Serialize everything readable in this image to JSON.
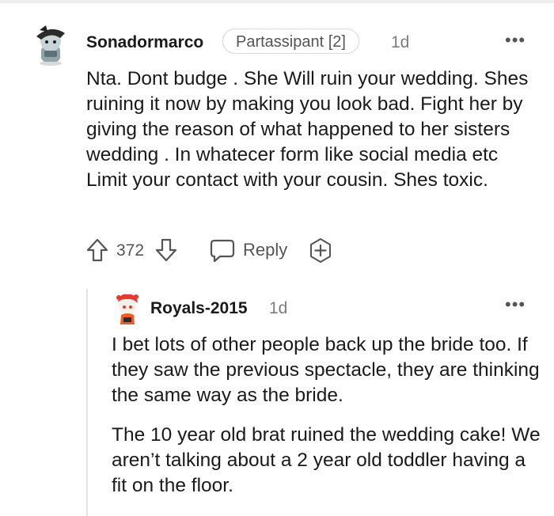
{
  "comment": {
    "username": "Sonadormarco",
    "flair": "Partassipant [2]",
    "age": "1d",
    "more": "•••",
    "body": "Nta. Dont budge . She Will ruin your wedding. Shes ruining it now by making you look bad. Fight her by giving the reason of what happened to her sisters wedding . In whatecer form like social media etc Limit your contact with your cousin. Shes toxic.",
    "actions": {
      "score": "372",
      "reply_label": "Reply"
    }
  },
  "reply": {
    "username": "Royals-2015",
    "age": "1d",
    "more": "•••",
    "paragraphs": [
      "I bet lots of other people back up the bride too. If they saw the previous spectacle, they are thinking the same way as the bride.",
      "The 10 year old brat ruined the wedding cake! We aren’t talking about a 2 year old toddler having a fit on the floor."
    ]
  },
  "icons": {
    "upvote": "arrow-up-outline-icon",
    "downvote": "arrow-down-outline-icon",
    "reply": "speech-bubble-icon",
    "award": "award-plus-icon"
  },
  "colors": {
    "text": "#1a1a1b",
    "meta": "#7c7c7c",
    "icon": "#555555",
    "thread_line": "#e3e3e3"
  }
}
